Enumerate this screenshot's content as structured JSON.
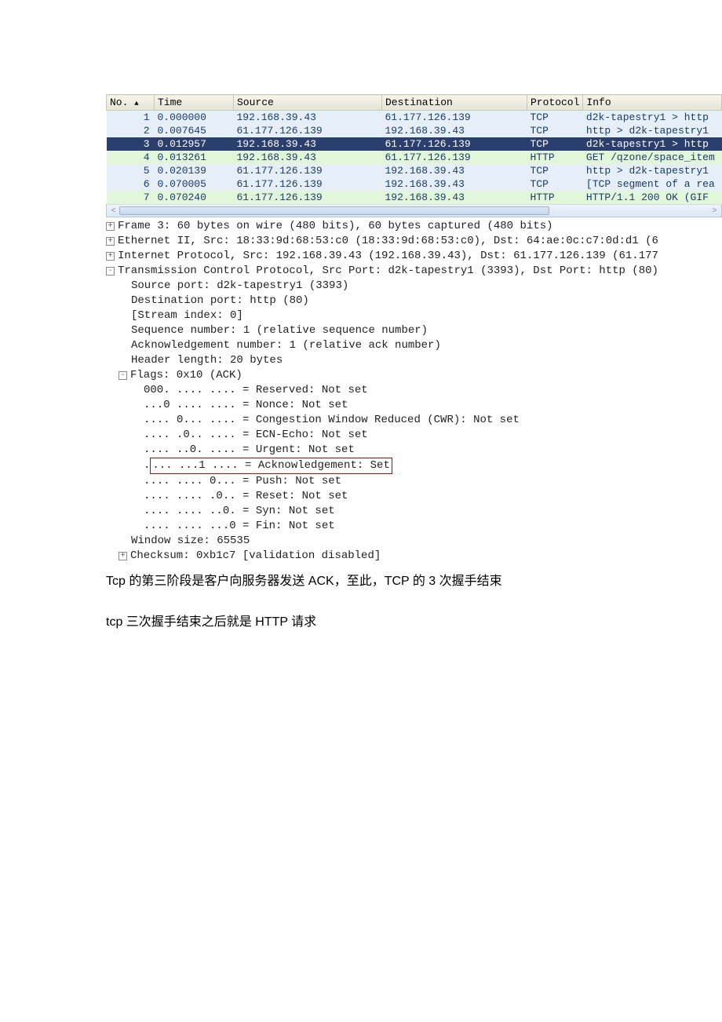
{
  "packets": {
    "headers": [
      "No.",
      "Time",
      "Source",
      "Destination",
      "Protocol",
      "Info"
    ],
    "rows": [
      {
        "no": "1",
        "time": "0.000000",
        "src": "192.168.39.43",
        "dst": "61.177.126.139",
        "proto": "TCP",
        "info": "d2k-tapestry1 > http",
        "style": "normal"
      },
      {
        "no": "2",
        "time": "0.007645",
        "src": "61.177.126.139",
        "dst": "192.168.39.43",
        "proto": "TCP",
        "info": "http > d2k-tapestry1",
        "style": "normal"
      },
      {
        "no": "3",
        "time": "0.012957",
        "src": "192.168.39.43",
        "dst": "61.177.126.139",
        "proto": "TCP",
        "info": "d2k-tapestry1 > http",
        "style": "selected"
      },
      {
        "no": "4",
        "time": "0.013261",
        "src": "192.168.39.43",
        "dst": "61.177.126.139",
        "proto": "HTTP",
        "info": "GET /qzone/space_item",
        "style": "http"
      },
      {
        "no": "5",
        "time": "0.020139",
        "src": "61.177.126.139",
        "dst": "192.168.39.43",
        "proto": "TCP",
        "info": "http > d2k-tapestry1",
        "style": "normal"
      },
      {
        "no": "6",
        "time": "0.070005",
        "src": "61.177.126.139",
        "dst": "192.168.39.43",
        "proto": "TCP",
        "info": "[TCP segment of a rea",
        "style": "normal"
      },
      {
        "no": "7",
        "time": "0.070240",
        "src": "61.177.126.139",
        "dst": "192.168.39.43",
        "proto": "HTTP",
        "info": "HTTP/1.1 200 OK  (GIF",
        "style": "http"
      }
    ]
  },
  "details": {
    "frame_line": "Frame 3: 60 bytes on wire (480 bits), 60 bytes captured (480 bits)",
    "eth_line": "Ethernet II, Src: 18:33:9d:68:53:c0 (18:33:9d:68:53:c0), Dst: 64:ae:0c:c7:0d:d1 (6",
    "ip_line": "Internet Protocol, Src: 192.168.39.43 (192.168.39.43), Dst: 61.177.126.139 (61.177",
    "tcp_line": "Transmission Control Protocol, Src Port: d2k-tapestry1 (3393), Dst Port: http (80)",
    "src_port": "Source port: d2k-tapestry1 (3393)",
    "dst_port": "Destination port: http (80)",
    "stream": "[Stream index: 0]",
    "seq": "Sequence number: 1    (relative sequence number)",
    "ack": "Acknowledgement number: 1    (relative ack number)",
    "hlen": "Header length: 20 bytes",
    "flags_head": "Flags: 0x10 (ACK)",
    "flags": [
      "000. .... .... = Reserved: Not set",
      "...0 .... .... = Nonce: Not set",
      ".... 0... .... = Congestion Window Reduced (CWR): Not set",
      ".... .0.. .... = ECN-Echo: Not set",
      ".... ..0. .... = Urgent: Not set",
      ".... ...1 .... = Acknowledgement: Set",
      ".... .... 0... = Push: Not set",
      ".... .... .0.. = Reset: Not set",
      ".... .... ..0. = Syn: Not set",
      ".... .... ...0 = Fin: Not set"
    ],
    "winsize": "Window size: 65535",
    "checksum": "Checksum: 0xb1c7 [validation disabled]"
  },
  "text1": "Tcp 的第三阶段是客户向服务器发送 ACK，至此，TCP 的 3 次握手结束",
  "text2": "tcp 三次握手结束之后就是 HTTP 请求"
}
